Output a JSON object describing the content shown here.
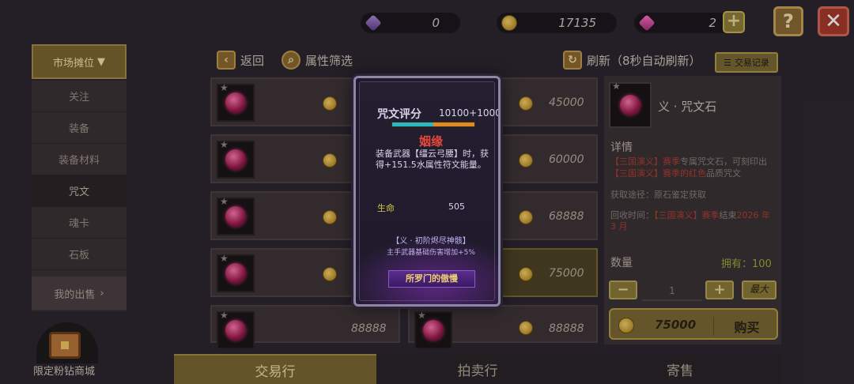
{
  "currency": {
    "diamonds": "0",
    "gold": "17135",
    "pink_diamonds": "2"
  },
  "buttons": {
    "help": "?",
    "close": "✕",
    "plus": "+"
  },
  "sidebar": {
    "header": "市场摊位",
    "items": [
      "关注",
      "装备",
      "装备材料",
      "咒文",
      "魂卡",
      "石板"
    ],
    "my_sales": "我的出售"
  },
  "toolbar": {
    "back": "返回",
    "filter": "属性筛选",
    "refresh": "刷新（8秒自动刷新）",
    "trade_log": "交易记录"
  },
  "market_items": [
    {
      "price": "45000"
    },
    {
      "price": "60000"
    },
    {
      "price": "68888"
    },
    {
      "price": "75000"
    },
    {
      "price": "88888"
    },
    {
      "price": "88888"
    }
  ],
  "detail": {
    "title": "义 · 咒文石",
    "section": "详情",
    "desc_pre": "",
    "desc_tag1": "【三国演义】",
    "desc_season1": "赛季",
    "desc_mid": "专属咒文石，可刻印出",
    "desc_tag2": "【三国演义】",
    "desc_season2": "赛季",
    "desc_color": "的红色",
    "desc_post": "品质咒文",
    "source": "获取途径：原石鉴定获取",
    "recycle_pre": "回收时间：",
    "recycle_tag": "【三国演义】",
    "recycle_season": "赛季",
    "recycle_post": "结束",
    "recycle_date": "2026 年 3 月",
    "quantity_label": "数量",
    "owned": "拥有：100",
    "minus": "−",
    "qty": "1",
    "plus": "+",
    "max": "最大",
    "buy_price": "75000",
    "buy": "购买"
  },
  "tabs": [
    "交易行",
    "拍卖行",
    "寄售"
  ],
  "shop_label": "限定粉钻商城",
  "popup": {
    "title": "咒文评分",
    "score": "10100+1000",
    "score_fraction": 0.5,
    "name": "姻缘",
    "description": "装备武器【缰云弓腰】时，获得+151.5水属性符文能量。",
    "stat_key": "生命",
    "stat_value": "505",
    "set_name": "【义 · 初阶烬尽神骸】",
    "set_effect": "主手武器基础伤害增加+5%",
    "ribbon": "所罗门的傲慢"
  }
}
